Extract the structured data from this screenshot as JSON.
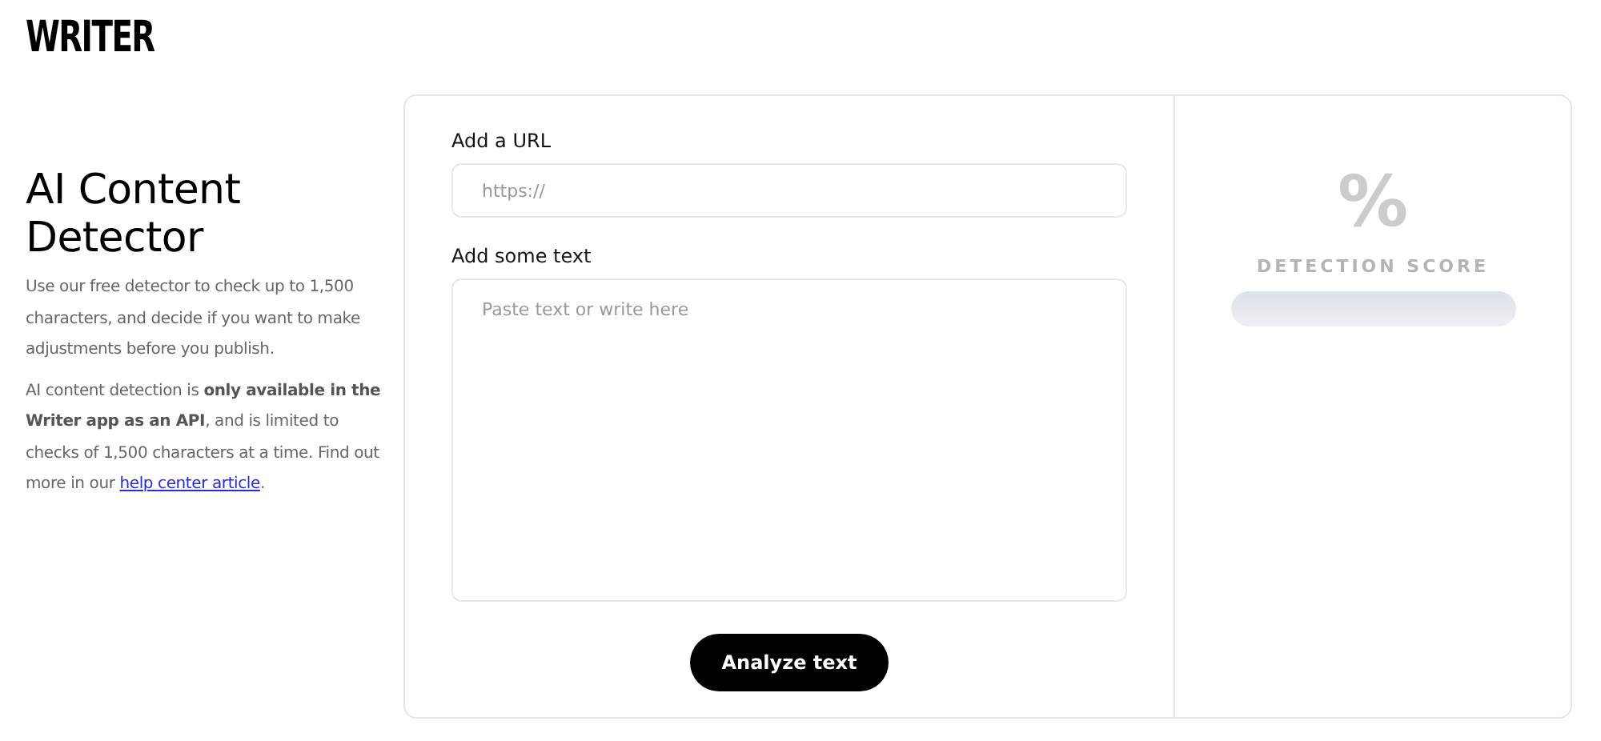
{
  "logo": "WRITER",
  "intro": {
    "title": "AI Content Detector",
    "paragraphs": [
      "Use our free detector to check up to 1,500 characters, and decide if you want to make adjustments before you publish.",
      "AI content detection is **only available in the Writer app as an API**, and is limited to checks of 1,500 characters at a time. Find out more in our"
    ],
    "link": "help center article",
    "link_after": "."
  },
  "form": {
    "url_label": "Add a URL",
    "url_placeholder": "https://",
    "text_label": "Add some text",
    "text_placeholder": "Paste text or write here",
    "button": "Analyze text"
  },
  "score": {
    "symbol": "%",
    "label": "DETECTION SCORE",
    "level": 0
  }
}
